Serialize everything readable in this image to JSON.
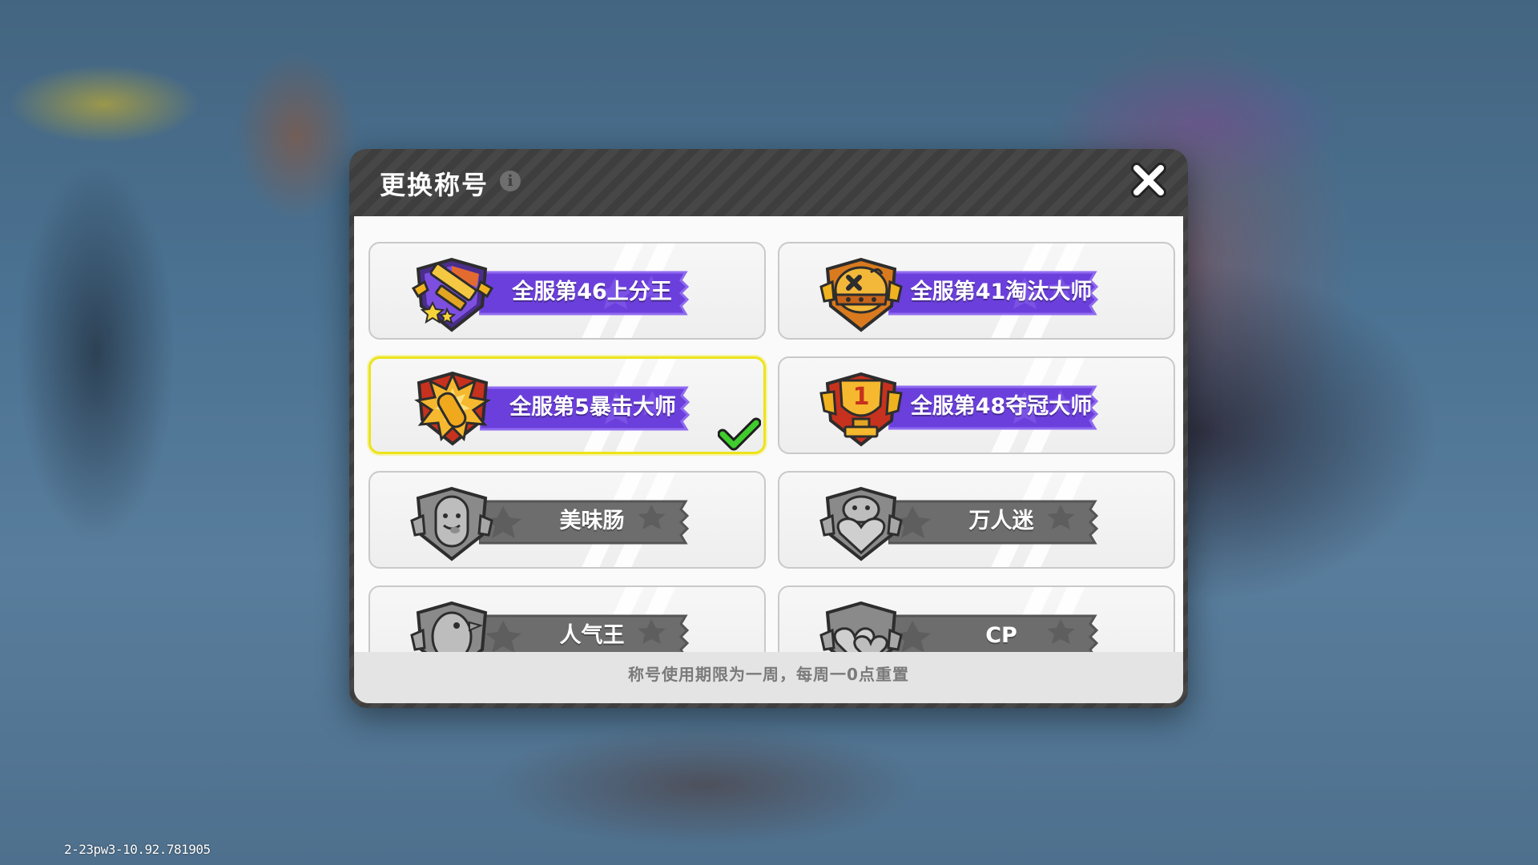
{
  "debug_info": "2-23pw3-10.92.781905",
  "dialog": {
    "title": "更换称号",
    "info_icon": "info-icon",
    "close_icon": "close-icon",
    "footer_note": "称号使用期限为一周，每周一0点重置"
  },
  "titles": [
    {
      "label": "全服第46上分王",
      "style": "purple",
      "badge_icon": "rocket-launcher-shield-badge",
      "selected": false
    },
    {
      "label": "全服第41淘汰大师",
      "style": "purple",
      "badge_icon": "skull-helmet-shield-badge",
      "selected": false
    },
    {
      "label": "全服第5暴击大师",
      "style": "purple",
      "badge_icon": "explosion-bullet-shield-badge",
      "selected": true
    },
    {
      "label": "全服第48夺冠大师",
      "style": "purple",
      "badge_icon": "trophy-number-one-badge",
      "selected": false
    },
    {
      "label": "美味肠",
      "style": "grey",
      "badge_icon": "sausage-face-badge",
      "selected": false
    },
    {
      "label": "万人迷",
      "style": "grey",
      "badge_icon": "heart-character-badge",
      "selected": false
    },
    {
      "label": "人气王",
      "style": "grey",
      "badge_icon": "bird-character-badge",
      "selected": false
    },
    {
      "label": "CP",
      "style": "grey",
      "badge_icon": "double-heart-badge",
      "selected": false
    }
  ],
  "colors": {
    "ribbon_purple": "#6b3fdb",
    "ribbon_purple_edge": "#8f6af0",
    "ribbon_grey": "#6d6d6d",
    "selected_border": "#ece41a",
    "check_green": "#3fcc2c"
  }
}
